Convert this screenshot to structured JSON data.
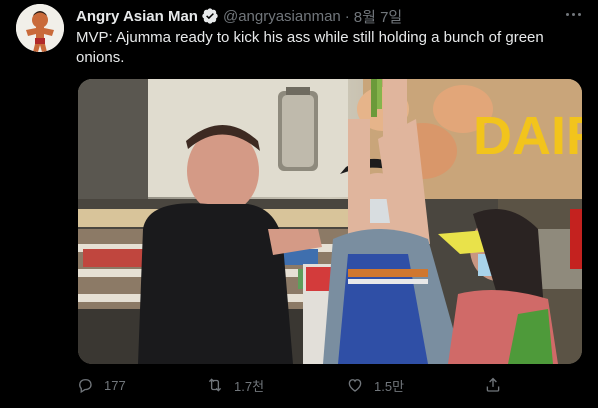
{
  "tweet": {
    "author_name": "Angry Asian Man",
    "handle": "@angryasianman",
    "separator": "·",
    "time": "8월 7일",
    "text": "MVP: Ajumma ready to kick his ass while still holding a bunch of green onions.",
    "media_description_icon": "video-still",
    "media_sign_text": "DAIR"
  },
  "actions": {
    "reply_count": "177",
    "retweet_count": "1.7천",
    "like_count": "1.5만",
    "share_label": ""
  },
  "colors": {
    "background": "#000000",
    "text_primary": "#e7e9ea",
    "text_secondary": "#71767b",
    "verified": "#1d9bf0",
    "sign_yellow": "#f2c41c"
  }
}
